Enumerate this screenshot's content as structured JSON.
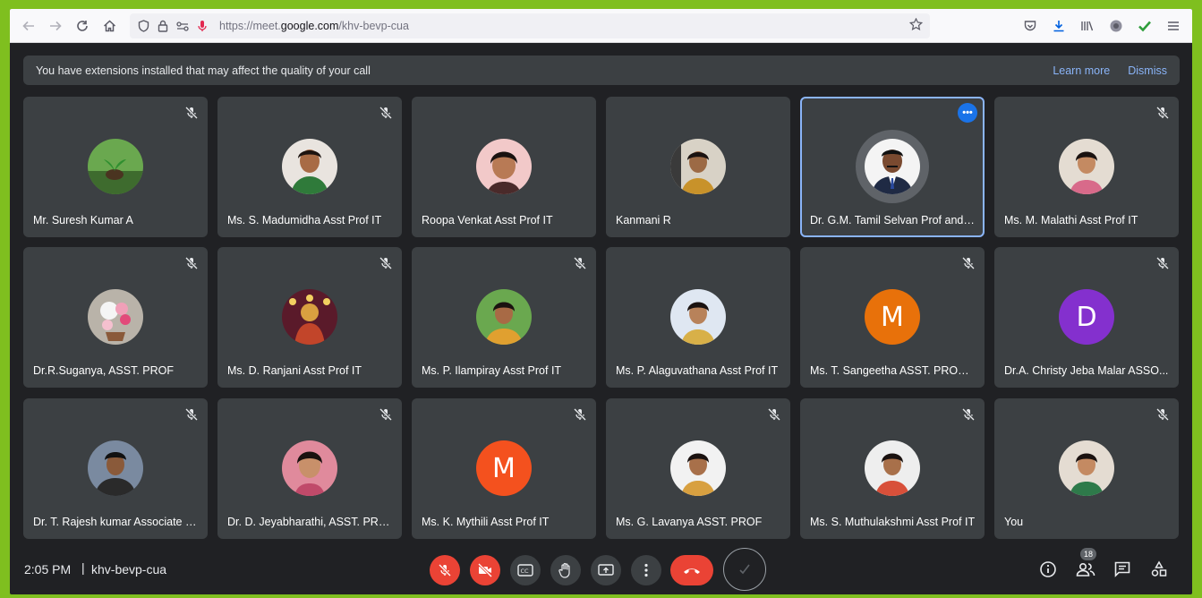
{
  "browser": {
    "url_prefix": "https://meet.",
    "url_domain": "google.com",
    "url_path": "/khv-bevp-cua"
  },
  "banner": {
    "message": "You have extensions installed that may affect the quality of your call",
    "learn_more": "Learn more",
    "dismiss": "Dismiss"
  },
  "participants": [
    {
      "name": "Mr. Suresh Kumar A",
      "avatar": "photo-plant",
      "muted": true
    },
    {
      "name": "Ms. S. Madumidha Asst Prof IT",
      "avatar": "photo-person",
      "muted": true
    },
    {
      "name": "Roopa Venkat Asst Prof IT",
      "avatar": "photo-person",
      "muted": false
    },
    {
      "name": "Kanmani R",
      "avatar": "photo-person",
      "muted": false
    },
    {
      "name": "Dr. G.M. Tamil Selvan Prof and ...",
      "avatar": "photo-person",
      "muted": false,
      "speaking": true
    },
    {
      "name": "Ms. M. Malathi Asst Prof IT",
      "avatar": "photo-person",
      "muted": true
    },
    {
      "name": "Dr.R.Suganya, ASST. PROF",
      "avatar": "photo-flowers",
      "muted": true
    },
    {
      "name": "Ms. D. Ranjani Asst Prof IT",
      "avatar": "photo-deity",
      "muted": true
    },
    {
      "name": "Ms. P. Ilampiray Asst Prof IT",
      "avatar": "photo-person",
      "muted": true
    },
    {
      "name": "Ms. P. Alaguvathana Asst Prof IT",
      "avatar": "photo-person",
      "muted": false
    },
    {
      "name": "Ms. T. Sangeetha ASST. PROF IT",
      "avatar": "M",
      "avatar_color": "#e8710a",
      "muted": true
    },
    {
      "name": "Dr.A. Christy Jeba Malar ASSO...",
      "avatar": "D",
      "avatar_color": "#8430ce",
      "muted": true
    },
    {
      "name": "Dr. T. Rajesh kumar Associate P...",
      "avatar": "photo-person",
      "muted": true
    },
    {
      "name": "Dr. D. Jeyabharathi, ASST. PROF",
      "avatar": "photo-person",
      "muted": true
    },
    {
      "name": "Ms. K. Mythili Asst Prof IT",
      "avatar": "M",
      "avatar_color": "#f4511e",
      "muted": true
    },
    {
      "name": "Ms. G. Lavanya ASST. PROF",
      "avatar": "photo-person",
      "muted": true
    },
    {
      "name": "Ms. S. Muthulakshmi Asst Prof IT",
      "avatar": "photo-person",
      "muted": true
    },
    {
      "name": "You",
      "avatar": "photo-person",
      "muted": true
    }
  ],
  "bottom_bar": {
    "time": "2:05 PM",
    "separator": "|",
    "meeting_code": "khv-bevp-cua",
    "people_count": "18"
  },
  "colors": {
    "accent": "#1a73e8",
    "end_call": "#ea4335",
    "tile": "#3c4043",
    "background": "#202124"
  }
}
